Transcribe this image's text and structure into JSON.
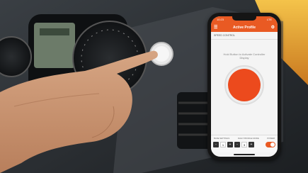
{
  "phone": {
    "status_time": "10:23",
    "status_right": "LTE",
    "app_title": "Active Profile",
    "section_label": "Speed Control",
    "hint_text": "Hold Button to Activate Controller Display",
    "bottom_labels": [
      "Base Settings",
      "Daily Profile Mode",
      "Power"
    ],
    "values": [
      "1",
      "3"
    ]
  },
  "colors": {
    "brand": "#e95a23",
    "button_core": "#ec4a1d"
  }
}
